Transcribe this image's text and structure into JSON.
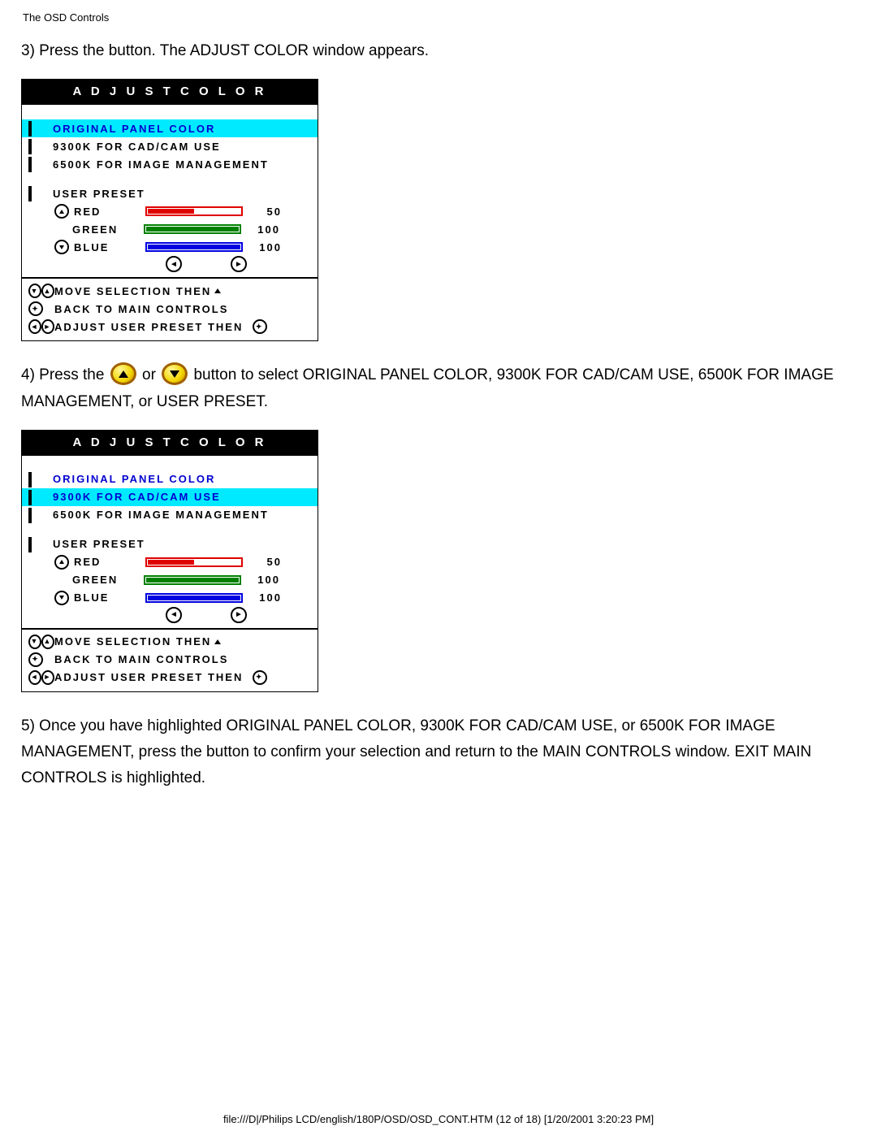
{
  "header": "The OSD Controls",
  "step3": "3) Press the      button. The ADJUST COLOR window appears.",
  "step4_a": "4) Press the ",
  "step4_b": " or ",
  "step4_c": " button to select ORIGINAL PANEL COLOR, 9300K FOR CAD/CAM USE, 6500K FOR IMAGE MANAGEMENT, or USER PRESET.",
  "step5": "5) Once you have highlighted ORIGINAL PANEL COLOR, 9300K FOR CAD/CAM USE, or 6500K FOR IMAGE MANAGEMENT, press the        button to confirm your selection and return to the MAIN CONTROLS window. EXIT MAIN CONTROLS is highlighted.",
  "osd": {
    "title": "A D J U S T  C O L O R",
    "items": {
      "original": "ORIGINAL PANEL COLOR",
      "k9300": "9300K FOR CAD/CAM USE",
      "k6500": "6500K FOR IMAGE MANAGEMENT",
      "user": "USER PRESET"
    },
    "rgb": {
      "red": {
        "label": "RED",
        "value": "50"
      },
      "green": {
        "label": "GREEN",
        "value": "100"
      },
      "blue": {
        "label": "BLUE",
        "value": "100"
      }
    },
    "foot": {
      "l1": "MOVE SELECTION THEN",
      "l2": "BACK TO MAIN CONTROLS",
      "l3": "ADJUST USER PRESET THEN"
    }
  },
  "footer": "file:///D|/Philips LCD/english/180P/OSD/OSD_CONT.HTM (12 of 18) [1/20/2001 3:20:23 PM]"
}
